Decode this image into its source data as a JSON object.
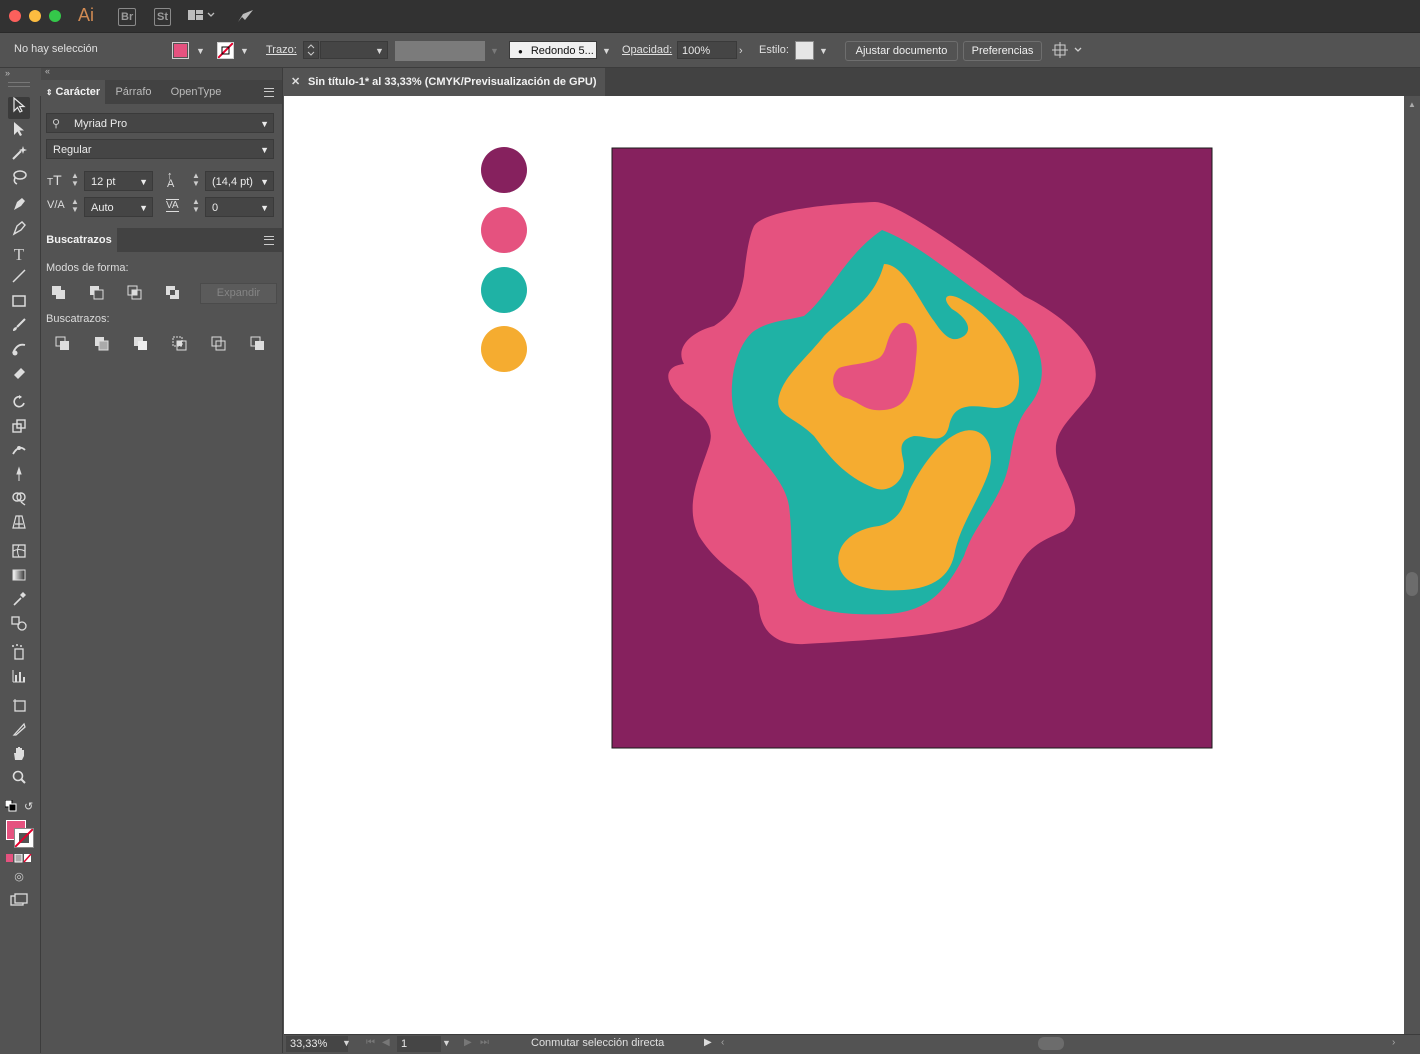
{
  "titlebar": {
    "app_icon": "Ai",
    "bridge": "Br",
    "stock": "St",
    "colors": {
      "close": "#fc605c",
      "minimize": "#fdbc40",
      "zoom": "#34c84a",
      "app_icon": "#d08a53"
    }
  },
  "control": {
    "selection_status": "No hay selección",
    "stroke_label": "Trazo:",
    "brush_label": "Redondo 5...",
    "opacity_label": "Opacidad:",
    "opacity_value": "100%",
    "style_label": "Estilo:",
    "fit_document_button": "Ajustar documento",
    "preferences_button": "Preferencias",
    "fill_color": "#e5527f"
  },
  "panel": {
    "tabs": [
      "Carácter",
      "Párrafo",
      "OpenType"
    ],
    "font_family": "Myriad Pro",
    "font_style": "Regular",
    "font_size": "12 pt",
    "leading": "(14,4 pt)",
    "kerning": "Auto",
    "tracking": "0",
    "pathfinder_tab": "Buscatrazos",
    "shape_modes_label": "Modos de forma:",
    "expand_button": "Expandir",
    "pathfinders_label": "Buscatrazos:"
  },
  "document": {
    "tab_title": "Sin título-1* al 33,33% (CMYK/Previsualización de GPU)",
    "zoom": "33,33%",
    "artboard_number": "1",
    "status_text": "Conmutar selección directa"
  },
  "artwork": {
    "background": "#86215e",
    "swatches": [
      "#86215e",
      "#e5527f",
      "#1fb2a5",
      "#f5ac30"
    ]
  }
}
